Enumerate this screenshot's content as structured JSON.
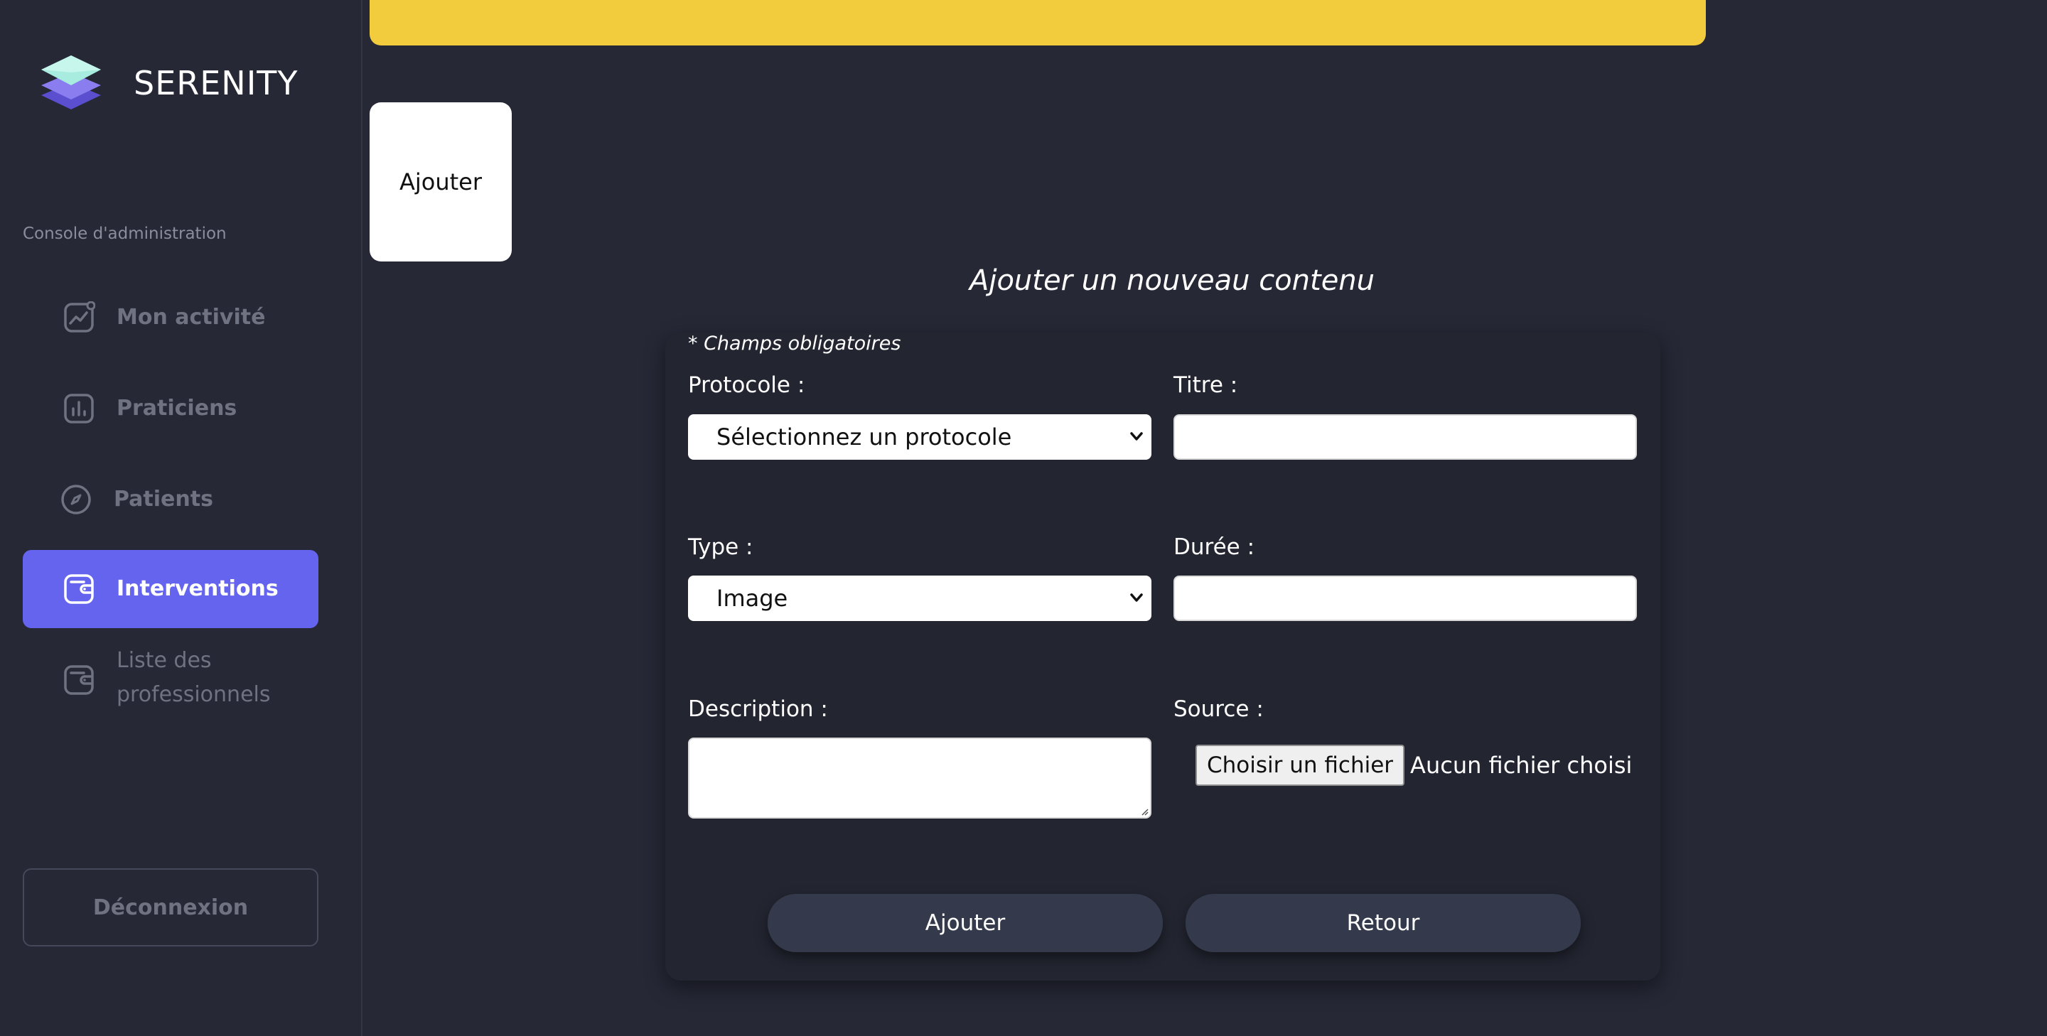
{
  "brand": {
    "name": "SERENITY",
    "logo_icon": "layers-icon"
  },
  "sidebar": {
    "section_label": "Console d'administration",
    "items": [
      {
        "label": "Mon activité",
        "icon": "activity-chart-icon",
        "active": false
      },
      {
        "label": "Praticiens",
        "icon": "bar-chart-icon",
        "active": false
      },
      {
        "label": "Patients",
        "icon": "compass-icon",
        "active": false
      },
      {
        "label": "Interventions",
        "icon": "wallet-icon",
        "active": true
      },
      {
        "label": "Liste des professionnels",
        "icon": "wallet-icon",
        "active": false
      }
    ],
    "logout_label": "Déconnexion",
    "active_color": "#6564ee"
  },
  "banner": {
    "color": "#f2cc3d"
  },
  "add_tile": {
    "label": "Ajouter"
  },
  "form": {
    "title": "Ajouter un nouveau contenu",
    "required_note": "* Champs obligatoires",
    "protocole": {
      "label": "Protocole :",
      "value": "Sélectionnez un protocole"
    },
    "titre": {
      "label": "Titre :",
      "value": ""
    },
    "type": {
      "label": "Type :",
      "value": "Image"
    },
    "duree": {
      "label": "Durée :",
      "value": ""
    },
    "description": {
      "label": "Description :",
      "value": ""
    },
    "source": {
      "label": "Source :",
      "button_label": "Choisir un fichier",
      "status": "Aucun fichier choisi"
    },
    "submit_label": "Ajouter",
    "back_label": "Retour"
  }
}
